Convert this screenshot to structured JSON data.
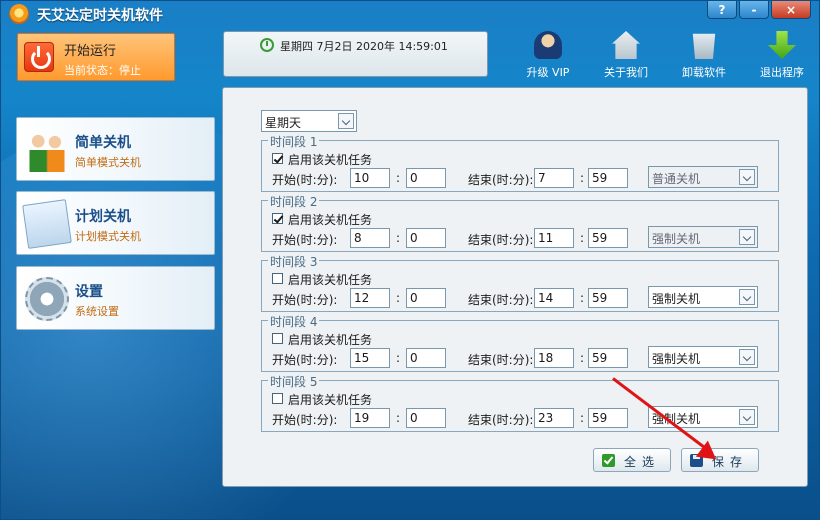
{
  "app": {
    "title": "天艾达定时关机软件",
    "window_buttons": {
      "help": "?",
      "minimize": "-",
      "close": "×"
    }
  },
  "start": {
    "label": "开始运行",
    "status": "当前状态：停止"
  },
  "datetime": "星期四 7月2日 2020年 14:59:01",
  "toolbar": [
    {
      "label": "升级 VIP",
      "icon": "vip-user-icon"
    },
    {
      "label": "关于我们",
      "icon": "home-icon"
    },
    {
      "label": "卸载软件",
      "icon": "recycle-bin-icon"
    },
    {
      "label": "退出程序",
      "icon": "down-arrow-icon"
    }
  ],
  "sidebar": [
    {
      "title": "简单关机",
      "subtitle": "简单模式关机",
      "icon": "people-icon"
    },
    {
      "title": "计划关机",
      "subtitle": "计划模式关机",
      "icon": "notepad-icon"
    },
    {
      "title": "设置",
      "subtitle": "系统设置",
      "icon": "gear-icon"
    }
  ],
  "panel": {
    "day_select": "星期天",
    "enable_label": "启用该关机任务",
    "start_label": "开始(时:分):",
    "end_label": "结束(时:分):",
    "colon": ":",
    "periods": [
      {
        "title": "时间段 1",
        "enabled": true,
        "start_h": "10",
        "start_m": "0",
        "end_h": "7",
        "end_m": "59",
        "action": "普通关机",
        "action_disabled": true
      },
      {
        "title": "时间段 2",
        "enabled": true,
        "start_h": "8",
        "start_m": "0",
        "end_h": "11",
        "end_m": "59",
        "action": "强制关机",
        "action_disabled": true
      },
      {
        "title": "时间段 3",
        "enabled": false,
        "start_h": "12",
        "start_m": "0",
        "end_h": "14",
        "end_m": "59",
        "action": "强制关机",
        "action_disabled": false
      },
      {
        "title": "时间段 4",
        "enabled": false,
        "start_h": "15",
        "start_m": "0",
        "end_h": "18",
        "end_m": "59",
        "action": "强制关机",
        "action_disabled": false
      },
      {
        "title": "时间段 5",
        "enabled": false,
        "start_h": "19",
        "start_m": "0",
        "end_h": "23",
        "end_m": "59",
        "action": "强制关机",
        "action_disabled": false
      }
    ],
    "select_all_label": "全选",
    "save_label": "保存"
  },
  "colors": {
    "accent_orange": "#ff9a2e",
    "title_blue": "#1b4f8a",
    "arrow_red": "#e01414"
  }
}
